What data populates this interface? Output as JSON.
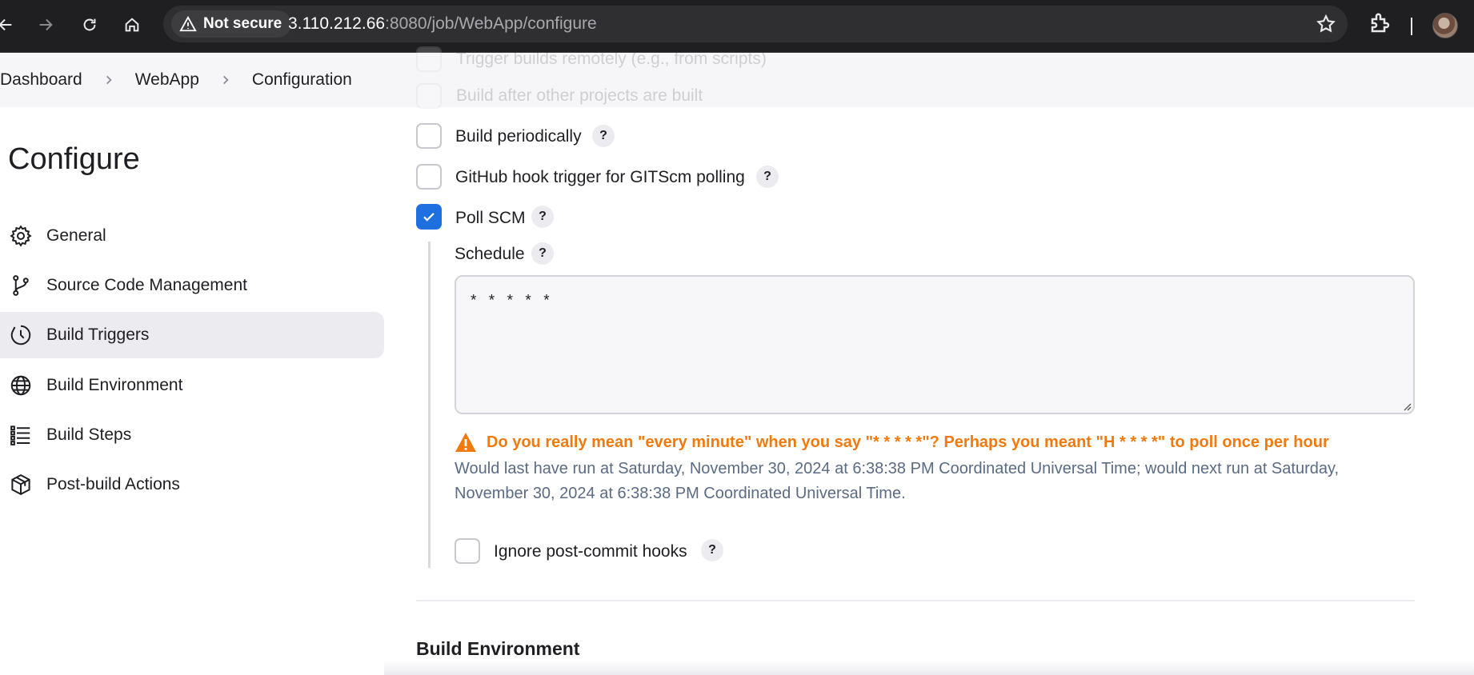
{
  "browser": {
    "security_label": "Not secure",
    "url_host": "3.110.212.66",
    "url_rest": ":8080/job/WebApp/configure"
  },
  "breadcrumb": [
    "Dashboard",
    "WebApp",
    "Configuration"
  ],
  "sidebar": {
    "title": "Configure",
    "items": [
      {
        "label": "General",
        "icon": "gear-icon"
      },
      {
        "label": "Source Code Management",
        "icon": "git-branch-icon"
      },
      {
        "label": "Build Triggers",
        "icon": "clock-icon",
        "active": true
      },
      {
        "label": "Build Environment",
        "icon": "globe-icon"
      },
      {
        "label": "Build Steps",
        "icon": "list-icon"
      },
      {
        "label": "Post-build Actions",
        "icon": "package-icon"
      }
    ]
  },
  "triggers": {
    "faded_options": [
      "Trigger builds remotely (e.g., from scripts)",
      "Build after other projects are built"
    ],
    "options": [
      {
        "label": "Build periodically",
        "checked": false
      },
      {
        "label": "GitHub hook trigger for GITScm polling",
        "checked": false
      },
      {
        "label": "Poll SCM",
        "checked": true
      }
    ],
    "help_label": "?",
    "schedule": {
      "label": "Schedule",
      "value": "* * * * *",
      "warning": "Do you really mean \"every minute\" when you say \"* * * * *\"? Perhaps you meant \"H * * * *\" to poll once per hour",
      "info": "Would last have run at Saturday, November 30, 2024 at 6:38:38 PM Coordinated Universal Time; would next run at Saturday, November 30, 2024 at 6:38:38 PM Coordinated Universal Time."
    },
    "ignore_hooks_label": "Ignore post-commit hooks"
  },
  "next_section_title": "Build Environment",
  "colors": {
    "accent": "#1e6fe0",
    "warning": "#f07a0e",
    "info": "#5a6b83"
  }
}
